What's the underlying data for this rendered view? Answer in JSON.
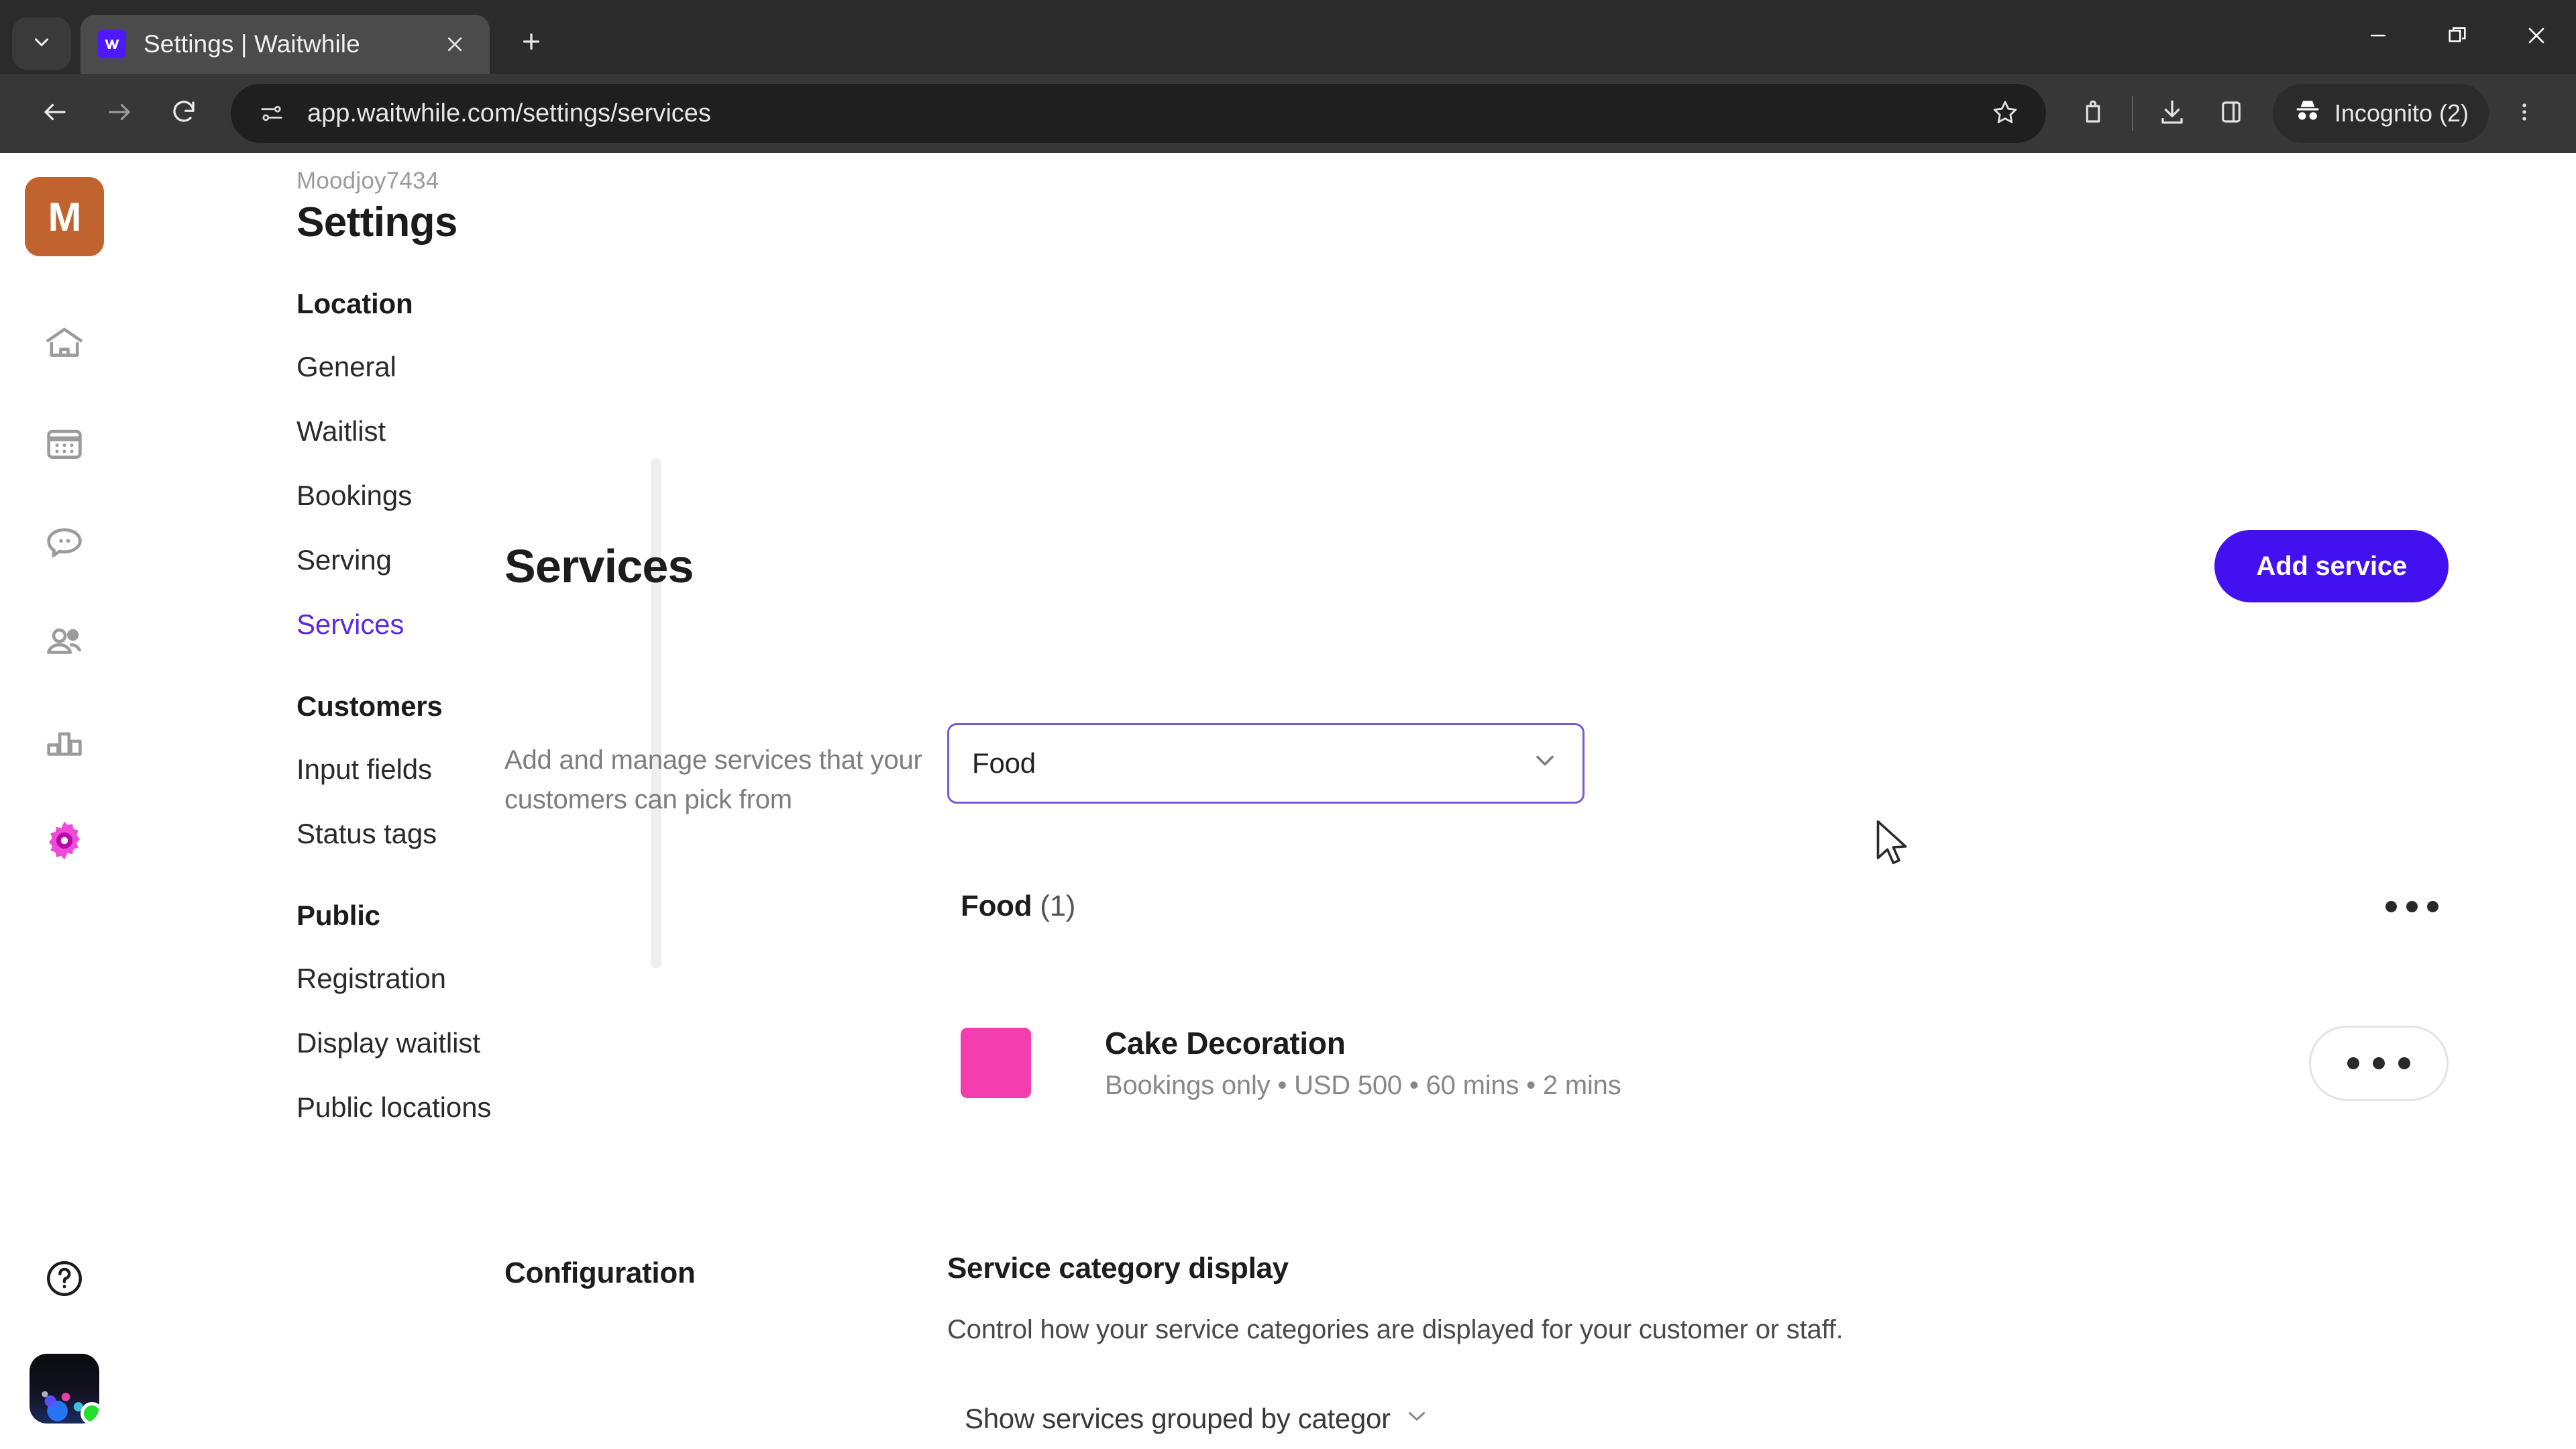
{
  "browser": {
    "tab": {
      "title": "Settings | Waitwhile",
      "favicon": "waitwhile-logo-icon"
    },
    "tab_list_icon": "chevron-down-icon",
    "new_tab_icon": "plus-icon",
    "tab_close_icon": "close-icon",
    "window_controls": {
      "minimize": "minimize-icon",
      "maximize": "maximize-icon",
      "close": "window-close-icon"
    },
    "toolbar": {
      "back": "back-arrow-icon",
      "forward": "forward-arrow-icon",
      "reload": "reload-icon",
      "site_info": "site-settings-icon",
      "url": "app.waitwhile.com/settings/services",
      "bookmark": "star-icon",
      "extensions": "extensions-icon",
      "downloads": "download-icon",
      "side_panel": "side-panel-icon",
      "profile_label": "Incognito (2)",
      "profile_icon": "incognito-icon",
      "menu": "three-dot-menu-icon"
    }
  },
  "rail": {
    "brand_initial": "M",
    "items": [
      {
        "name": "home",
        "icon": "home-icon",
        "active": false
      },
      {
        "name": "calendar",
        "icon": "calendar-icon",
        "active": false
      },
      {
        "name": "messages",
        "icon": "chat-bubble-icon",
        "active": false
      },
      {
        "name": "customers",
        "icon": "people-icon",
        "active": false
      },
      {
        "name": "analytics",
        "icon": "bar-chart-icon",
        "active": false
      },
      {
        "name": "settings",
        "icon": "gear-icon",
        "active": true
      }
    ],
    "help_icon": "question-circle-icon",
    "avatar_icon": "user-avatar",
    "status": "online"
  },
  "settings_nav": {
    "org_name": "Moodjoy7434",
    "title": "Settings",
    "groups": [
      {
        "heading": "Location",
        "links": [
          {
            "label": "General",
            "active": false
          },
          {
            "label": "Waitlist",
            "active": false
          },
          {
            "label": "Bookings",
            "active": false
          },
          {
            "label": "Serving",
            "active": false
          },
          {
            "label": "Services",
            "active": true
          }
        ]
      },
      {
        "heading": "Customers",
        "links": [
          {
            "label": "Input fields",
            "active": false
          },
          {
            "label": "Status tags",
            "active": false
          }
        ]
      },
      {
        "heading": "Public",
        "links": [
          {
            "label": "Registration",
            "active": false
          },
          {
            "label": "Display waitlist",
            "active": false
          },
          {
            "label": "Public locations",
            "active": false
          }
        ]
      }
    ]
  },
  "main": {
    "heading": "Services",
    "add_button": "Add service",
    "description": "Add and manage services that your customers can pick from",
    "category_select": {
      "value": "Food",
      "chevron": "chevron-down-icon"
    },
    "category_group": {
      "name": "Food",
      "count": "(1)",
      "menu_icon": "three-dot-menu-icon"
    },
    "services": [
      {
        "name": "Cake Decoration",
        "meta": "Bookings only • USD 500 • 60 mins • 2 mins",
        "color": "#f23eae",
        "menu_icon": "three-dot-menu-icon"
      }
    ],
    "configuration": {
      "section_label": "Configuration",
      "title": "Service category display",
      "description": "Control how your service categories are displayed for your customer or staff.",
      "select": {
        "value": "Show services grouped by categor",
        "chevron": "chevron-down-icon"
      }
    }
  },
  "colors": {
    "accent_purple": "#4310f0",
    "active_link": "#5b2ae0",
    "service_swatch": "#f23eae",
    "brand_tile": "#c0632e"
  }
}
